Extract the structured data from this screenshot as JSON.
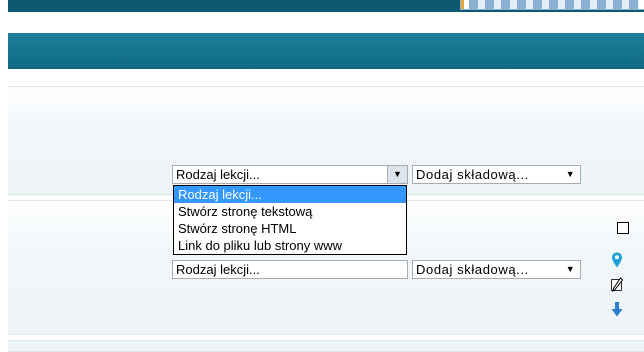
{
  "lesson_type_select": {
    "value": "Rodzaj lekcji...",
    "options": [
      "Rodzaj lekcji...",
      "Stwórz stronę tekstową",
      "Stwórz stronę HTML",
      "Link do pliku lub strony www"
    ],
    "selected_index": 0
  },
  "add_component_select": {
    "value": "Dodaj składową..."
  },
  "lesson_type_select_2": {
    "value": "Rodzaj lekcji..."
  },
  "add_component_select_2": {
    "value": "Dodaj składową..."
  },
  "icons": {
    "caret": "▼",
    "row_actions": [
      "checkbox-icon",
      "location-pin-icon",
      "edit-icon",
      "move-down-icon"
    ]
  },
  "colors": {
    "header": "#0f6a83",
    "selection": "#3399ff",
    "pin": "#1fa0d8",
    "arrow": "#2a7fd0"
  }
}
